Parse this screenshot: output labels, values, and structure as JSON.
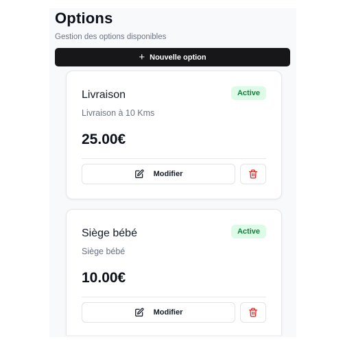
{
  "header": {
    "title": "Options",
    "subtitle": "Gestion des options disponibles"
  },
  "new_button": {
    "icon": "plus-icon",
    "label": "Nouvelle option"
  },
  "options": [
    {
      "name": "Livraison",
      "status": "Active",
      "description": "Livraison à 10 Kms",
      "price": "25.00€",
      "modify_label": "Modifier"
    },
    {
      "name": "Siège bébé",
      "status": "Active",
      "description": "Siège bébé",
      "price": "10.00€",
      "modify_label": "Modifier"
    }
  ],
  "colors": {
    "primary_button": "#17171a",
    "badge_bg": "#dcfce7",
    "badge_text": "#15803d",
    "delete_icon": "#dc2626"
  }
}
